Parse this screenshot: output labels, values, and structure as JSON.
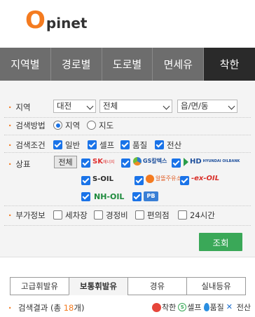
{
  "logo": {
    "o": "O",
    "text": "pinet"
  },
  "tabs": [
    {
      "label": "지역별",
      "active": false
    },
    {
      "label": "경로별",
      "active": false
    },
    {
      "label": "도로별",
      "active": false
    },
    {
      "label": "면세유",
      "active": false
    },
    {
      "label": "착한",
      "active": true
    }
  ],
  "filters": {
    "region": {
      "label": "지역",
      "sido": "대전",
      "sigungu": "전체",
      "dong": "읍/면/동"
    },
    "method": {
      "label": "검색방법",
      "options": [
        "지역",
        "지도"
      ],
      "selected": "지역"
    },
    "conditions": {
      "label": "검색조건",
      "options": [
        {
          "label": "일반",
          "checked": true
        },
        {
          "label": "셀프",
          "checked": true
        },
        {
          "label": "품질",
          "checked": true
        },
        {
          "label": "전산",
          "checked": true
        }
      ]
    },
    "brand": {
      "label": "상표",
      "all_button": "전체",
      "items": [
        {
          "name": "SK에너지",
          "logo_text": "SK",
          "logo_sub": "에너지",
          "checked": true
        },
        {
          "name": "GS칼텍스",
          "logo_text": "GS칼텍스",
          "checked": true
        },
        {
          "name": "HD현대오일뱅크",
          "logo_text": "HD",
          "logo_sub": "HYUNDAI OILBANK",
          "checked": true
        },
        {
          "name": "S-OIL",
          "logo_text": "S-OIL",
          "checked": true
        },
        {
          "name": "알뜰주유소",
          "logo_text": "알뜰주유소",
          "checked": true
        },
        {
          "name": "ex-OIL",
          "logo_text": "-ex-OIL",
          "checked": true
        },
        {
          "name": "NH-OIL",
          "logo_text": "NH-OIL",
          "checked": true
        },
        {
          "name": "PB",
          "logo_text": "PB",
          "checked": true
        }
      ]
    },
    "extra": {
      "label": "부가정보",
      "options": [
        {
          "label": "세차장",
          "checked": false
        },
        {
          "label": "경정비",
          "checked": false
        },
        {
          "label": "편의점",
          "checked": false
        },
        {
          "label": "24시간",
          "checked": false
        }
      ]
    },
    "search_button": "조회"
  },
  "fuel_tabs": [
    {
      "label": "고급휘발유",
      "active": false
    },
    {
      "label": "보통휘발유",
      "active": true
    },
    {
      "label": "경유",
      "active": false
    },
    {
      "label": "실내등유",
      "active": false
    }
  ],
  "result": {
    "prefix": "검색결과 (총 ",
    "count": "18",
    "suffix": "개)"
  },
  "legend": [
    {
      "label": "착한",
      "icon": "good-station-icon"
    },
    {
      "label": "셀프",
      "icon": "self-icon"
    },
    {
      "label": "품질",
      "icon": "quality-drop-icon"
    },
    {
      "label": "전산",
      "icon": "computerized-icon"
    }
  ]
}
